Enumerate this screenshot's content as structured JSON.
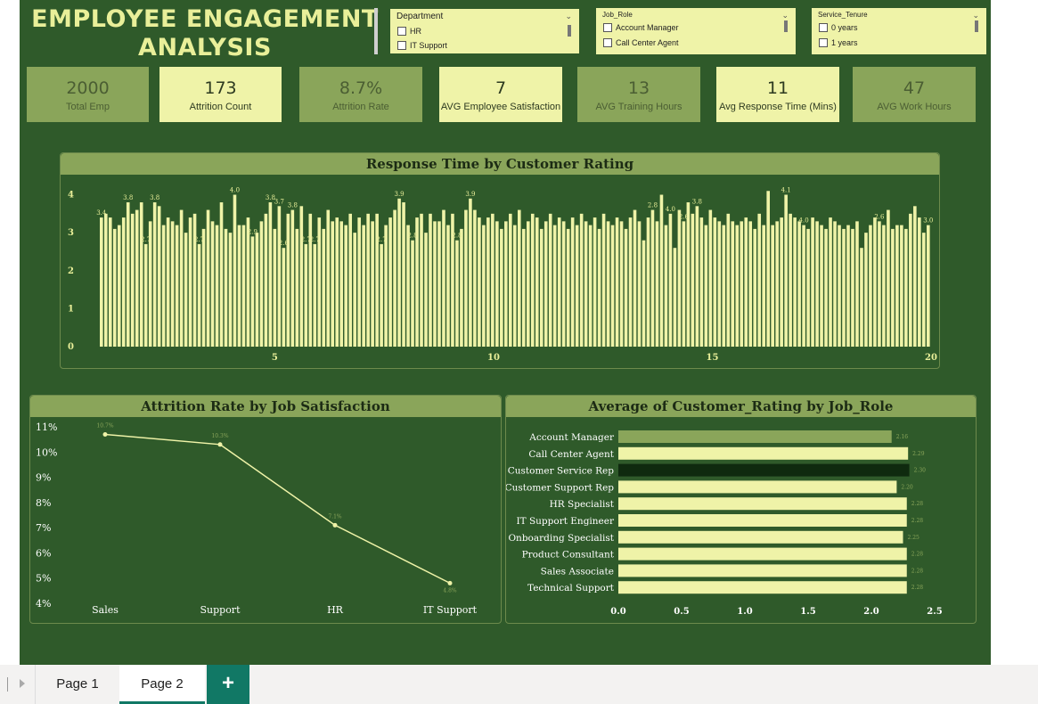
{
  "title": "EMPLOYEE ENGAGEMENT ANALYSIS",
  "slicers": [
    {
      "name": "department",
      "header": "Department",
      "options": [
        "HR",
        "IT Support"
      ]
    },
    {
      "name": "job-role",
      "header": "Job_Role",
      "options": [
        "Account Manager",
        "Call Center Agent"
      ]
    },
    {
      "name": "service-tenure",
      "header": "Service_Tenure",
      "options": [
        "0 years",
        "1 years"
      ]
    }
  ],
  "kpis": [
    {
      "value": "2000",
      "label": "Total Emp"
    },
    {
      "value": "173",
      "label": "Attrition Count"
    },
    {
      "value": "8.7%",
      "label": "Attrition Rate"
    },
    {
      "value": "7",
      "label": "AVG Employee Satisfaction"
    },
    {
      "value": "13",
      "label": "AVG Training Hours"
    },
    {
      "value": "11",
      "label": "Avg Response Time (Mins)"
    },
    {
      "value": "47",
      "label": "AVG Work Hours"
    }
  ],
  "chart_data": [
    {
      "type": "bar",
      "title": "Response Time by Customer Rating",
      "ylim": [
        0,
        4.2
      ],
      "yticks": [
        "0",
        "1",
        "2",
        "3",
        "4"
      ],
      "xticks": [
        "5",
        "10",
        "15",
        "20"
      ],
      "xlim": [
        1,
        20
      ],
      "values": [
        3.4,
        3.5,
        3.4,
        3.1,
        3.2,
        3.4,
        3.8,
        3.5,
        3.6,
        3.8,
        2.7,
        3.3,
        3.8,
        3.7,
        3.2,
        3.4,
        3.3,
        3.2,
        3.6,
        3.0,
        3.4,
        3.5,
        2.7,
        3.1,
        3.6,
        3.3,
        3.2,
        3.8,
        3.1,
        3.0,
        4.0,
        3.2,
        3.2,
        3.4,
        2.9,
        3.0,
        3.3,
        3.5,
        3.8,
        3.1,
        3.7,
        2.6,
        3.5,
        3.6,
        3.1,
        3.7,
        2.7,
        3.5,
        2.7,
        3.4,
        3.1,
        3.6,
        3.3,
        3.4,
        3.3,
        3.2,
        3.5,
        3.0,
        3.4,
        3.2,
        3.5,
        3.3,
        3.5,
        2.7,
        3.2,
        3.4,
        3.6,
        3.9,
        3.8,
        3.2,
        2.8,
        3.4,
        3.5,
        3.0,
        3.5,
        3.3,
        3.3,
        3.6,
        3.2,
        3.5,
        2.8,
        3.1,
        3.6,
        3.9,
        3.6,
        3.4,
        3.2,
        3.4,
        3.5,
        3.3,
        3.1,
        3.3,
        3.5,
        3.2,
        3.6,
        3.1,
        3.3,
        3.5,
        3.4,
        3.1,
        3.3,
        3.5,
        3.2,
        3.4,
        3.3,
        3.1,
        3.4,
        3.2,
        3.5,
        3.3,
        3.2,
        3.4,
        3.1,
        3.5,
        3.3,
        3.2,
        3.4,
        3.3,
        3.1,
        3.4,
        3.6,
        3.3,
        2.8,
        3.4,
        3.6,
        3.3,
        4.0,
        3.2,
        3.5,
        2.6,
        3.6,
        3.3,
        3.8,
        3.5,
        3.7,
        3.4,
        3.2,
        3.6,
        3.4,
        3.3,
        3.2,
        3.5,
        3.3,
        3.2,
        3.3,
        3.4,
        3.3,
        3.1,
        3.5,
        3.2,
        4.1,
        3.2,
        3.3,
        3.4,
        4.0,
        3.5,
        3.4,
        3.3,
        3.2,
        3.1,
        3.4,
        3.3,
        3.2,
        3.1,
        3.4,
        3.3,
        3.2,
        3.1,
        3.2,
        3.1,
        3.3,
        2.6,
        3.0,
        3.2,
        3.4,
        3.3,
        3.2,
        3.6,
        3.1,
        3.2,
        3.2,
        3.1,
        3.5,
        3.7,
        3.4,
        3.0,
        3.2
      ],
      "data_labels": [
        {
          "i": 0,
          "text": "3.4"
        },
        {
          "i": 6,
          "text": "3.8"
        },
        {
          "i": 12,
          "text": "3.8"
        },
        {
          "i": 10,
          "text": "2.7"
        },
        {
          "i": 30,
          "text": "4.0"
        },
        {
          "i": 22,
          "text": "2.7"
        },
        {
          "i": 34,
          "text": "2.9"
        },
        {
          "i": 38,
          "text": "3.8"
        },
        {
          "i": 40,
          "text": "3.7"
        },
        {
          "i": 41,
          "text": "2.6"
        },
        {
          "i": 43,
          "text": "3.8"
        },
        {
          "i": 46,
          "text": "2.7"
        },
        {
          "i": 48,
          "text": "2.7"
        },
        {
          "i": 63,
          "text": "2.7"
        },
        {
          "i": 67,
          "text": "3.9"
        },
        {
          "i": 70,
          "text": "2.8"
        },
        {
          "i": 80,
          "text": "2.8"
        },
        {
          "i": 83,
          "text": "3.9"
        },
        {
          "i": 128,
          "text": "4.0"
        },
        {
          "i": 124,
          "text": "2.8"
        },
        {
          "i": 131,
          "text": "2.6"
        },
        {
          "i": 134,
          "text": "3.8"
        },
        {
          "i": 154,
          "text": "4.1"
        },
        {
          "i": 158,
          "text": "4.0"
        },
        {
          "i": 175,
          "text": "2.6"
        },
        {
          "i": 186,
          "text": "3.0"
        }
      ]
    },
    {
      "type": "line",
      "title": "Attrition Rate by Job Satisfaction",
      "categories": [
        "Sales",
        "Support",
        "HR",
        "IT Support"
      ],
      "values": [
        10.7,
        10.3,
        7.1,
        4.8
      ],
      "value_labels": [
        "10.7%",
        "10.3%",
        "7.1%",
        "4.8%"
      ],
      "yticks": [
        "4%",
        "5%",
        "6%",
        "7%",
        "8%",
        "9%",
        "10%",
        "11%"
      ],
      "ylim": [
        4,
        11
      ]
    },
    {
      "type": "bar",
      "orientation": "horizontal",
      "title": "Average of Customer_Rating by Job_Role",
      "categories": [
        "Account Manager",
        "Call Center Agent",
        "Customer Service Rep",
        "Customer Support Rep",
        "HR Specialist",
        "IT Support Engineer",
        "Onboarding Specialist",
        "Product Consultant",
        "Sales Associate",
        "Technical Support"
      ],
      "values": [
        2.16,
        2.29,
        2.3,
        2.2,
        2.28,
        2.28,
        2.25,
        2.28,
        2.28,
        2.28
      ],
      "value_labels": [
        "2.16",
        "2.29",
        "2.30",
        "2.20",
        "2.28",
        "2.28",
        "2.25",
        "2.28",
        "2.28",
        "2.28"
      ],
      "bar_colors": [
        "#8aa55a",
        "#eff3a8",
        "#0f2a0f",
        "#eff3a8",
        "#eff3a8",
        "#eff3a8",
        "#eff3a8",
        "#eff3a8",
        "#eff3a8",
        "#eff3a8"
      ],
      "xticks": [
        "0.0",
        "0.5",
        "1.0",
        "1.5",
        "2.0",
        "2.5"
      ],
      "xlim": [
        0,
        2.5
      ]
    }
  ],
  "tabs": {
    "page1": "Page 1",
    "page2": "Page 2",
    "add": "+"
  },
  "colors": {
    "background": "#2f5a2a",
    "accent": "#eff3a8",
    "kpi_dark": "#8aa55a",
    "tab_accent": "#117865"
  }
}
